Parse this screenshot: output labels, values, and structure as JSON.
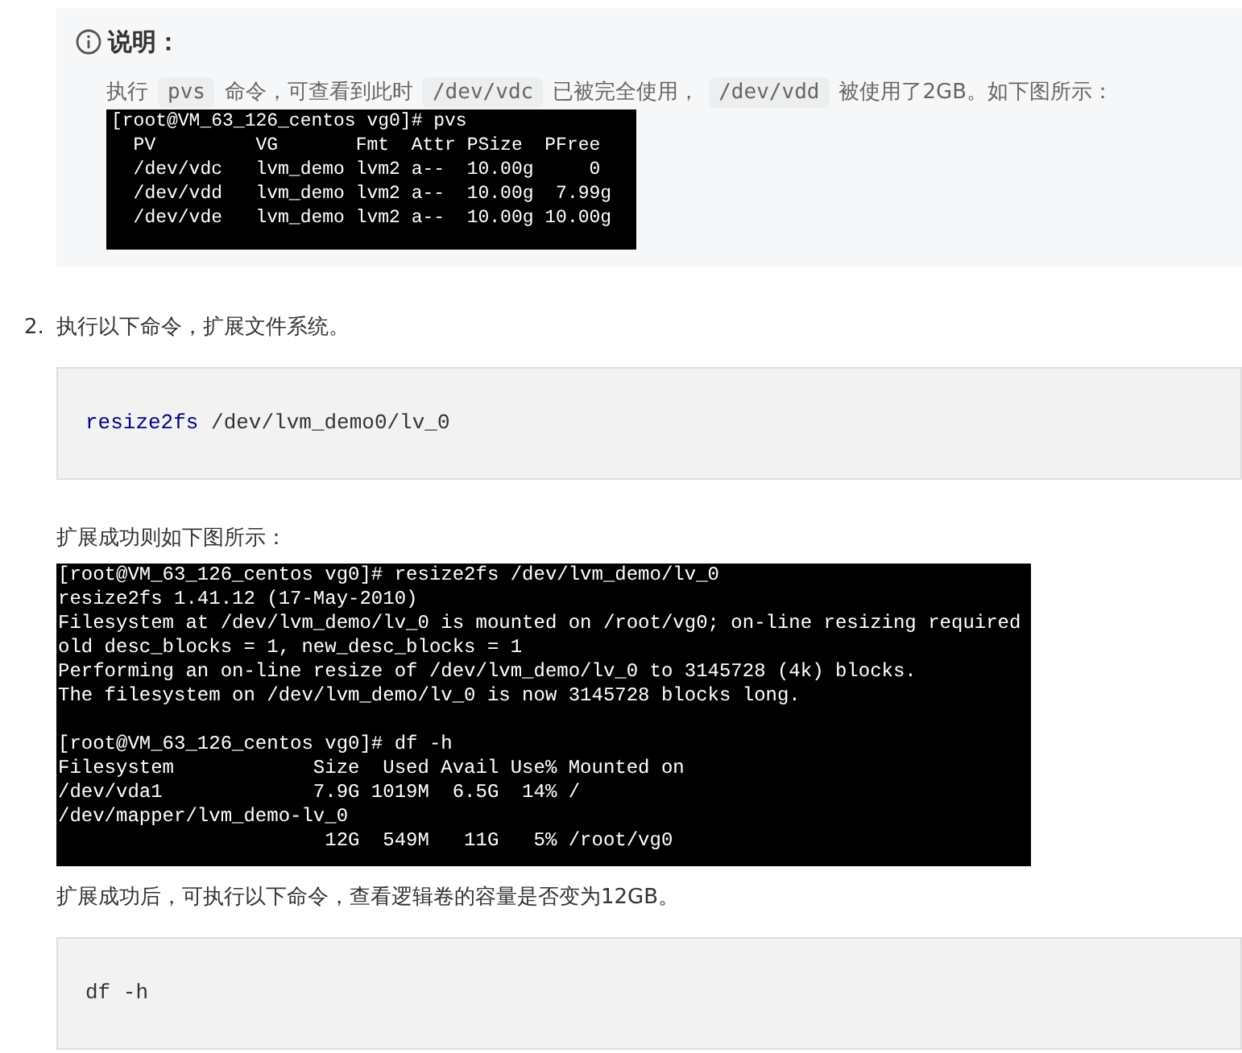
{
  "note": {
    "title": "说明：",
    "paragraph": [
      {
        "kind": "text",
        "text": "执行"
      },
      {
        "kind": "code",
        "text": "pvs"
      },
      {
        "kind": "text",
        "text": "命令，可查看到此时"
      },
      {
        "kind": "code",
        "text": "/dev/vdc"
      },
      {
        "kind": "text",
        "text": "已被完全使用，"
      },
      {
        "kind": "code",
        "text": "/dev/vdd"
      },
      {
        "kind": "text",
        "text": "被使用了2GB。如下图所示："
      }
    ],
    "terminal": [
      "[root@VM_63_126_centos vg0]# pvs",
      "  PV         VG       Fmt  Attr PSize  PFree",
      "  /dev/vdc   lvm_demo lvm2 a--  10.00g     0",
      "  /dev/vdd   lvm_demo lvm2 a--  10.00g  7.99g",
      "  /dev/vde   lvm_demo lvm2 a--  10.00g 10.00g"
    ]
  },
  "step": {
    "number": "2.",
    "text": "执行以下命令，扩展文件系统。",
    "code_block": [
      {
        "text": "resize2fs",
        "keyword": true
      },
      {
        "text": "/dev/lvm_demo0/lv_0",
        "keyword": false
      }
    ],
    "caption": "扩展成功则如下图所示：",
    "terminal_blocks": [
      [
        "[root@VM_63_126_centos vg0]# resize2fs /dev/lvm_demo/lv_0",
        "resize2fs 1.41.12 (17-May-2010)",
        "Filesystem at /dev/lvm_demo/lv_0 is mounted on /root/vg0; on-line resizing required",
        "old desc_blocks = 1, new_desc_blocks = 1",
        "Performing an on-line resize of /dev/lvm_demo/lv_0 to 3145728 (4k) blocks.",
        "The filesystem on /dev/lvm_demo/lv_0 is now 3145728 blocks long."
      ],
      [
        "[root@VM_63_126_centos vg0]# df -h",
        "Filesystem            Size  Used Avail Use% Mounted on",
        "/dev/vda1             7.9G 1019M  6.5G  14% /",
        "/dev/mapper/lvm_demo-lv_0",
        "                       12G  549M   11G   5% /root/vg0"
      ]
    ],
    "caption_2": "扩展成功后，可执行以下命令，查看逻辑卷的容量是否变为12GB。",
    "code_block_2": [
      {
        "text": "df -h",
        "keyword": false
      }
    ]
  }
}
